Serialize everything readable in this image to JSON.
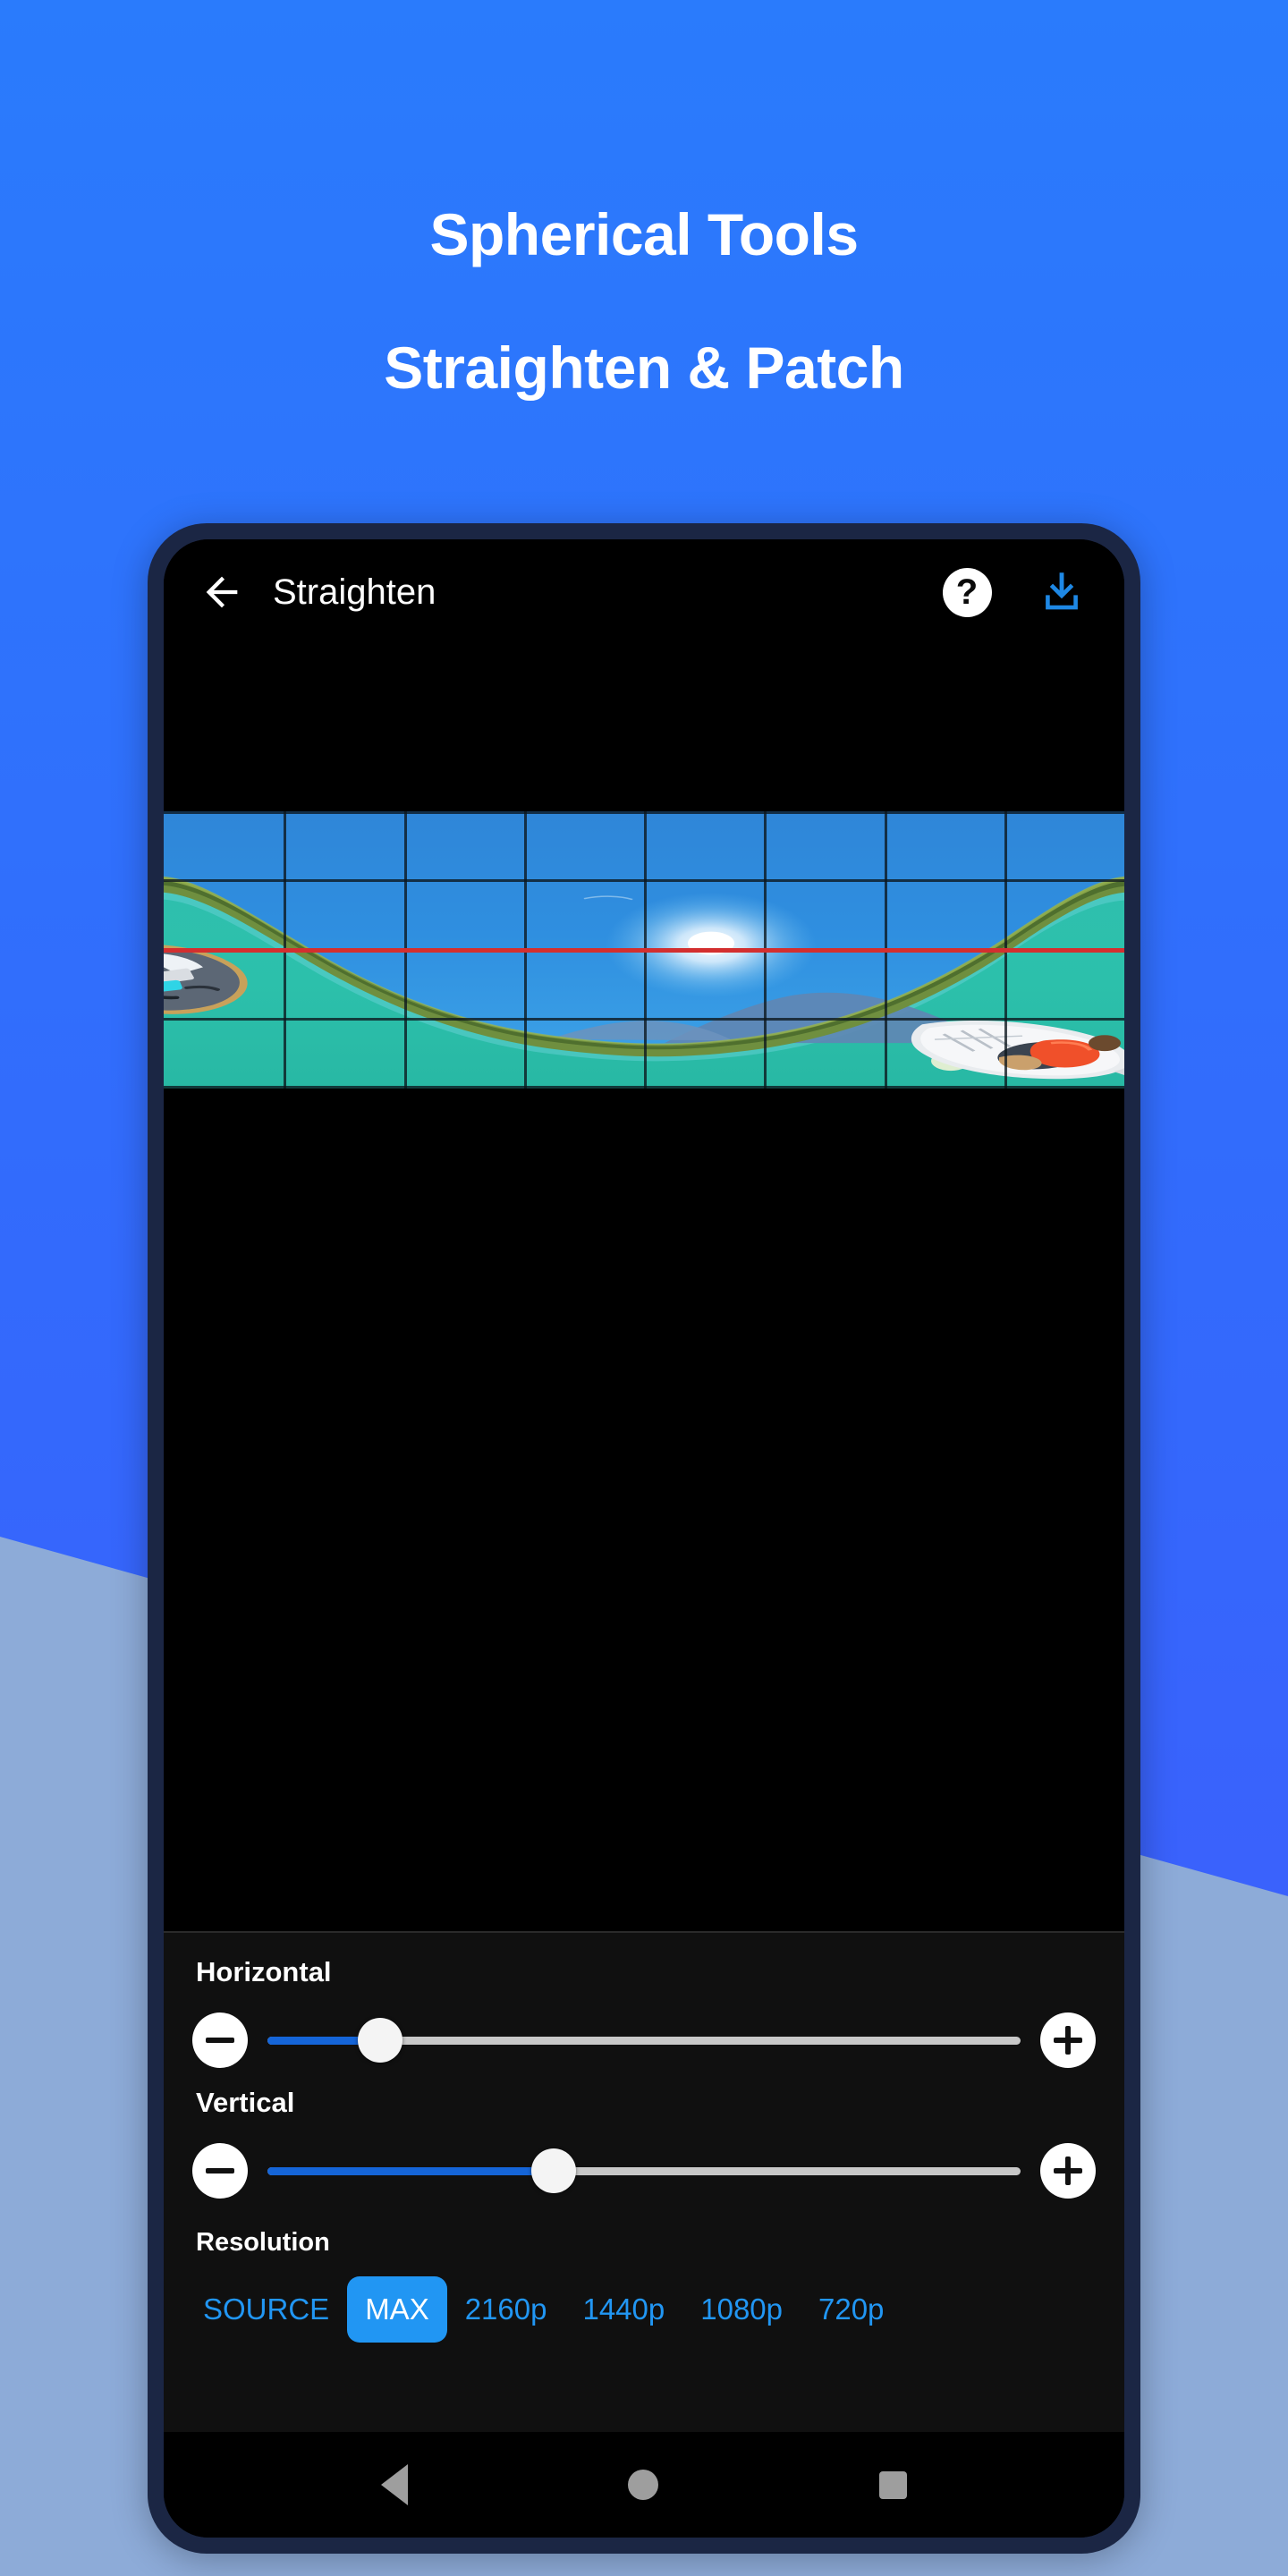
{
  "promo": {
    "headline_line1": "Spherical Tools",
    "headline_line2": "Straighten & Patch",
    "background_top_color": "#2a7bfc",
    "background_bottom_color": "#4358fc",
    "accent_band_color": "#8dabd8"
  },
  "appbar": {
    "back_icon": "arrow-left-icon",
    "title": "Straighten",
    "help_icon_label": "?",
    "download_icon": "download-icon",
    "download_icon_color": "#1e88e5"
  },
  "preview": {
    "canvas_background": "#000000",
    "grid_columns": 8,
    "grid_rows": 4,
    "horizon_line_color": "#d32f2f",
    "scene_description": "360 equirectangular lake panorama with kayaks, tilted horizon"
  },
  "controls": {
    "horizontal": {
      "label": "Horizontal",
      "minus_icon": "minus-icon",
      "plus_icon": "plus-icon",
      "value_percent": 15,
      "fill_color": "#1565d8",
      "track_color": "#c8c8c8"
    },
    "vertical": {
      "label": "Vertical",
      "minus_icon": "minus-icon",
      "plus_icon": "plus-icon",
      "value_percent": 38,
      "fill_color": "#1565d8",
      "track_color": "#c8c8c8"
    },
    "resolution": {
      "label": "Resolution",
      "selected": "MAX",
      "accent_color": "#2196f3",
      "options": [
        {
          "label": "SOURCE",
          "selected": false
        },
        {
          "label": "MAX",
          "selected": true
        },
        {
          "label": "2160p",
          "selected": false
        },
        {
          "label": "1440p",
          "selected": false
        },
        {
          "label": "1080p",
          "selected": false
        },
        {
          "label": "720p",
          "selected": false
        }
      ]
    }
  },
  "navbar": {
    "back_icon": "triangle-back-icon",
    "home_icon": "circle-home-icon",
    "recents_icon": "square-recents-icon",
    "icon_color": "#9e9e9e"
  }
}
